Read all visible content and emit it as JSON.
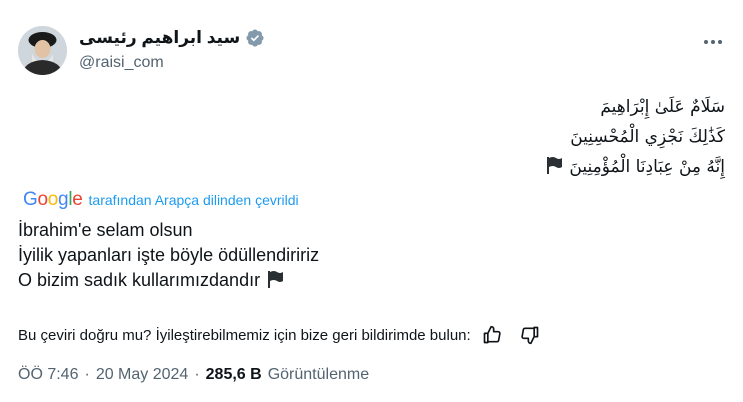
{
  "author": {
    "display_name": "سید ابراهیم رئیسی",
    "handle": "@raisi_com",
    "avatar_icon": "avatar-portrait",
    "verified_icon": "verified-badge-icon",
    "verified_color": "#829aab"
  },
  "more_icon": "more-options-icon",
  "original_text": {
    "lines": [
      "سَلَامٌ عَلَىٰ إِبْرَاهِيمَ",
      "كَذَٰلِكَ نَجْزِي الْمُحْسِنِينَ",
      "إِنَّهُ مِنْ عِبَادِنَا الْمُؤْمِنِينَ"
    ],
    "trailing_icon": "black-flag-icon"
  },
  "translation_notice": {
    "brand": "Google",
    "text": "tarafından Arapça dilinden çevrildi"
  },
  "translated_text": {
    "lines": [
      "İbrahim'e selam olsun",
      "İyilik yapanları işte böyle ödüllendiririz",
      "O bizim sadık kullarımızdandır"
    ],
    "trailing_icon": "black-flag-icon"
  },
  "feedback": {
    "prompt": "Bu çeviri doğru mu? İyileştirebilmemiz için bize geri bildirimde bulun:",
    "thumbs_up_icon": "thumbs-up-icon",
    "thumbs_down_icon": "thumbs-down-icon"
  },
  "meta": {
    "time": "ÖÖ 7:46",
    "separator": "·",
    "date": "20 May 2024",
    "views_count": "285,6 B",
    "views_label": "Görüntülenme"
  },
  "colors": {
    "text_primary": "#0f1419",
    "text_secondary": "#536471",
    "link_blue": "#1d9bf0"
  }
}
